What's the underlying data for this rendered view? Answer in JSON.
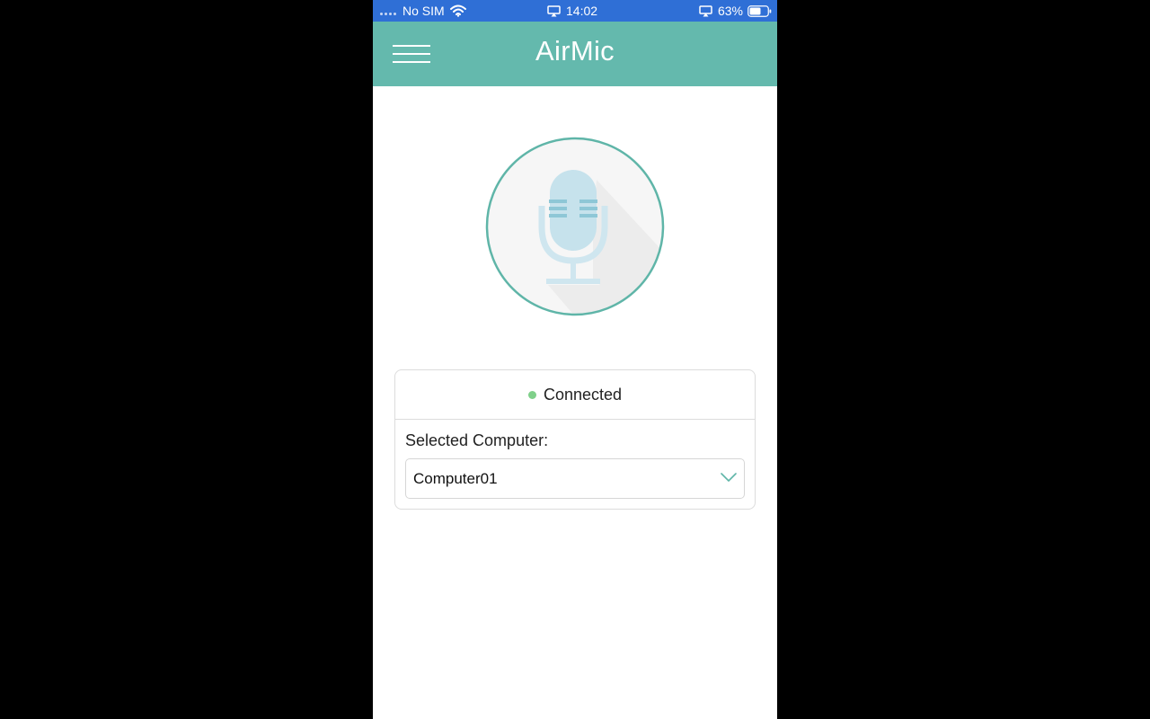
{
  "status_bar": {
    "carrier": "No SIM",
    "time": "14:02",
    "battery": "63%",
    "battery_level": 0.63,
    "icons": [
      "signal-dots-icon",
      "wifi-icon",
      "airplay-icon",
      "airplay-icon",
      "battery-icon"
    ]
  },
  "header": {
    "title": "AirMic",
    "menu_icon": "hamburger-menu-icon"
  },
  "mic": {
    "icon": "microphone-icon"
  },
  "connection": {
    "status": "Connected",
    "status_color": "#7fd08a",
    "selected_label": "Selected Computer:",
    "selected_value": "Computer01",
    "dropdown_icon": "chevron-down-icon"
  },
  "colors": {
    "status_bar": "#2f6fd6",
    "header": "#64b9ad",
    "accent": "#5fb5a8",
    "mic": "#c6e2ec"
  }
}
